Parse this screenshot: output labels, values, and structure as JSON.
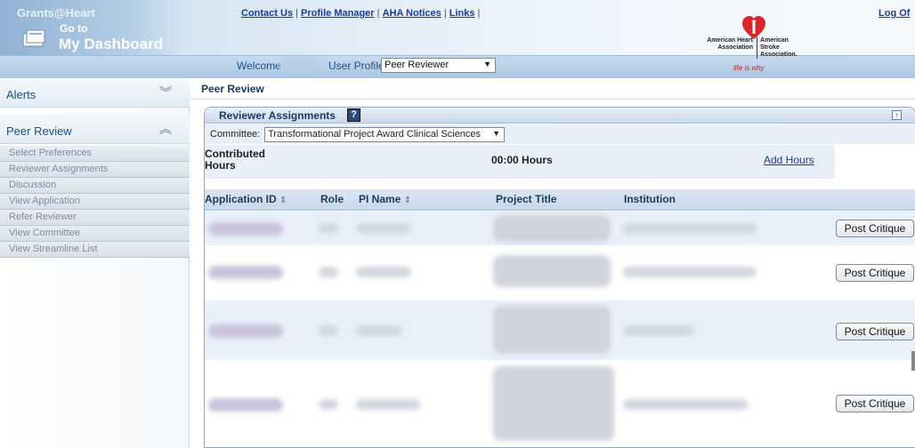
{
  "header": {
    "brand": "Grants@Heart",
    "goto": "Go to",
    "dashboard": "My Dashboard",
    "links": [
      "Contact Us",
      "Profile Manager",
      "AHA Notices",
      "Links"
    ],
    "logout": "Log Of",
    "welcome": "Welcome",
    "profile_label": "User Profile",
    "profile_value": "Peer Reviewer",
    "aha": {
      "left": "American Heart Association",
      "right": "American Stroke Association.",
      "tagline": "life is why"
    }
  },
  "sidebar": {
    "alerts": "Alerts",
    "peer_review": "Peer Review",
    "items": [
      "Select Preferences",
      "Reviewer Assignments",
      "Discussion",
      "View Application",
      "Refer Reviewer",
      "View Committee",
      "View Streamline List"
    ]
  },
  "main": {
    "title": "Peer Review",
    "panel_title": "Reviewer Assignments",
    "help": "?",
    "collapse": "↑",
    "committee_label": "Committee:",
    "committee_value": "Transformational Project Award Clinical Sciences",
    "hours_label": "Contributed Hours",
    "hours_value": "00:00 Hours",
    "add_hours": "Add Hours",
    "columns": {
      "app_id": "Application ID",
      "role": "Role",
      "pi_name": "PI Name",
      "title": "Project Title",
      "institution": "Institution"
    },
    "post_critique": "Post Critique"
  },
  "colors": {
    "header_blue": "#1e4f86",
    "link_blue": "#1a3a9c",
    "row_alt": "#e9f0fa",
    "aha_red": "#c1272d"
  }
}
